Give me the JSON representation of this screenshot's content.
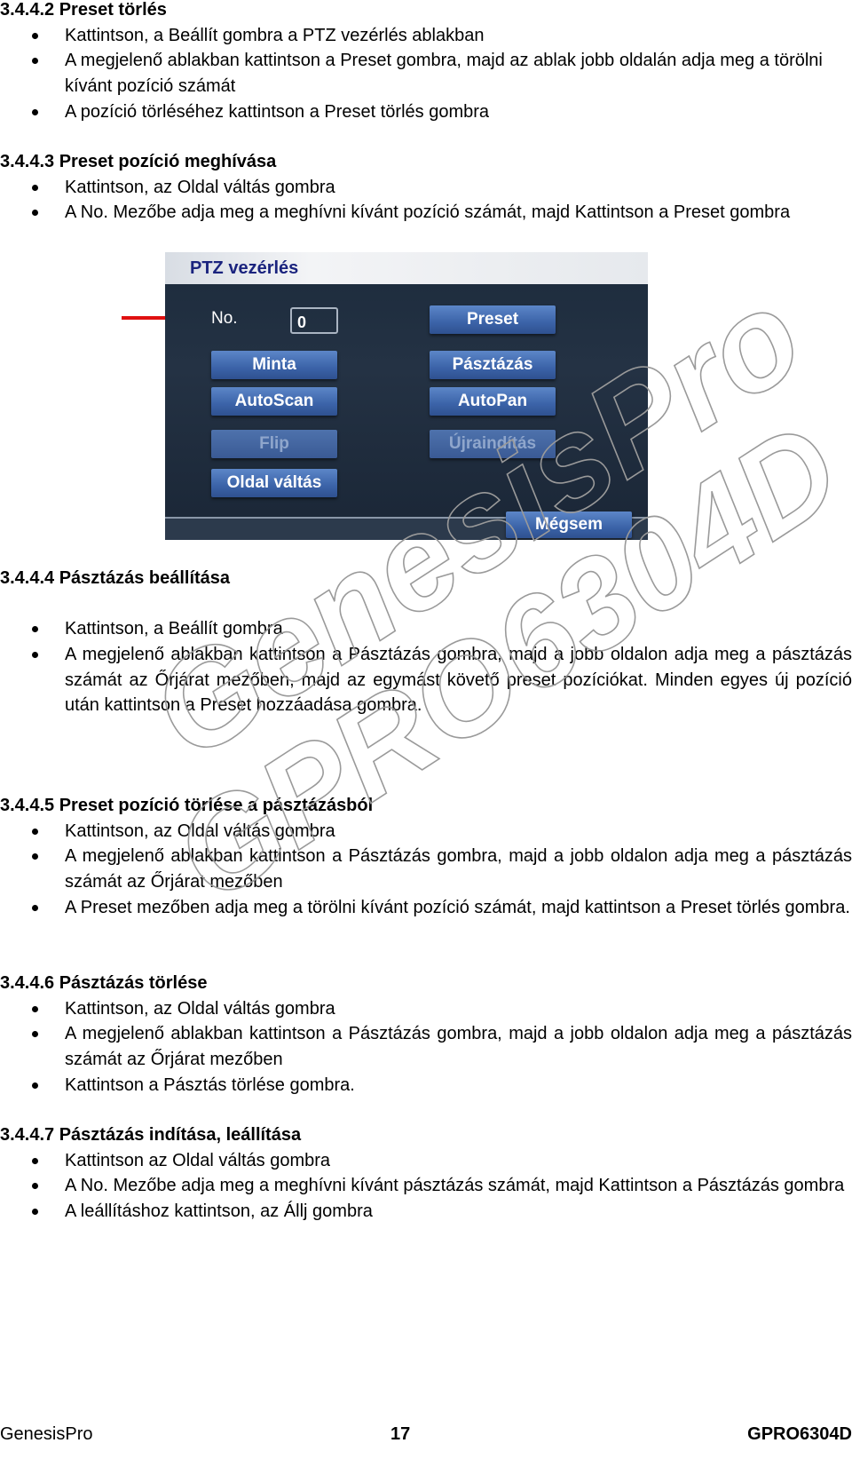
{
  "sections": [
    {
      "heading": "3.4.4.2 Preset törlés",
      "items": [
        "Kattintson, a Beállít gombra a PTZ vezérlés ablakban",
        "A megjelenő ablakban kattintson a Preset gombra, majd az ablak jobb oldalán adja meg a törölni kívánt pozíció számát",
        "A pozíció törléséhez kattintson a Preset törlés gombra"
      ]
    },
    {
      "heading": "3.4.4.3 Preset pozíció meghívása",
      "items": [
        "Kattintson, az Oldal váltás gombra",
        "A No. Mezőbe adja meg a meghívni kívánt pozíció számát, majd Kattintson a Preset gombra"
      ]
    },
    {
      "heading": "3.4.4.4 Pásztázás beállítása",
      "items": [
        "Kattintson, a Beállít gombra",
        "A megjelenő ablakban kattintson a Pásztázás gombra, majd a jobb oldalon adja meg a pásztázás számát az Őrjárat mezőben, majd az egymást követő preset pozíciókat. Minden egyes új pozíció után kattintson a Preset hozzáadása gombra."
      ]
    },
    {
      "heading": "3.4.4.5 Preset pozíció törlése a pásztázásból",
      "items": [
        "Kattintson, az Oldal váltás gombra",
        "A megjelenő ablakban kattintson a Pásztázás gombra, majd a jobb oldalon adja meg a pásztázás számát az Őrjárat mezőben",
        "A Preset mezőben adja meg a törölni kívánt pozíció számát, majd kattintson a Preset törlés gombra."
      ]
    },
    {
      "heading": "3.4.4.6 Pásztázás törlése",
      "items": [
        "Kattintson, az Oldal váltás gombra",
        "A megjelenő ablakban kattintson a Pásztázás gombra, majd a jobb oldalon adja meg a pásztázás számát az Őrjárat mezőben",
        "Kattintson a Pásztás törlése gombra."
      ]
    },
    {
      "heading": "3.4.4.7 Pásztázás indítása, leállítása",
      "items": [
        "Kattintson az Oldal váltás gombra",
        "A No. Mezőbe adja meg a meghívni kívánt pásztázás számát, majd Kattintson a Pásztázás gombra",
        "A leállításhoz kattintson, az Állj gombra"
      ]
    }
  ],
  "screenshot": {
    "title": "PTZ vezérlés",
    "no_label": "No.",
    "no_value": "0",
    "buttons": {
      "preset": "Preset",
      "minta": "Minta",
      "pasztazas": "Pásztázás",
      "autoscan": "AutoScan",
      "autopan": "AutoPan",
      "flip": "Flip",
      "ujrainditas": "Újraindítás",
      "oldal_valtas": "Oldal váltás",
      "megsem": "Mégsem"
    },
    "arrow_color": "#e01010"
  },
  "watermark": {
    "line1": "GenesisPro",
    "line2": "GPRO6304D"
  },
  "footer": {
    "left": "GenesisPro",
    "page": "17",
    "right": "GPRO6304D"
  }
}
